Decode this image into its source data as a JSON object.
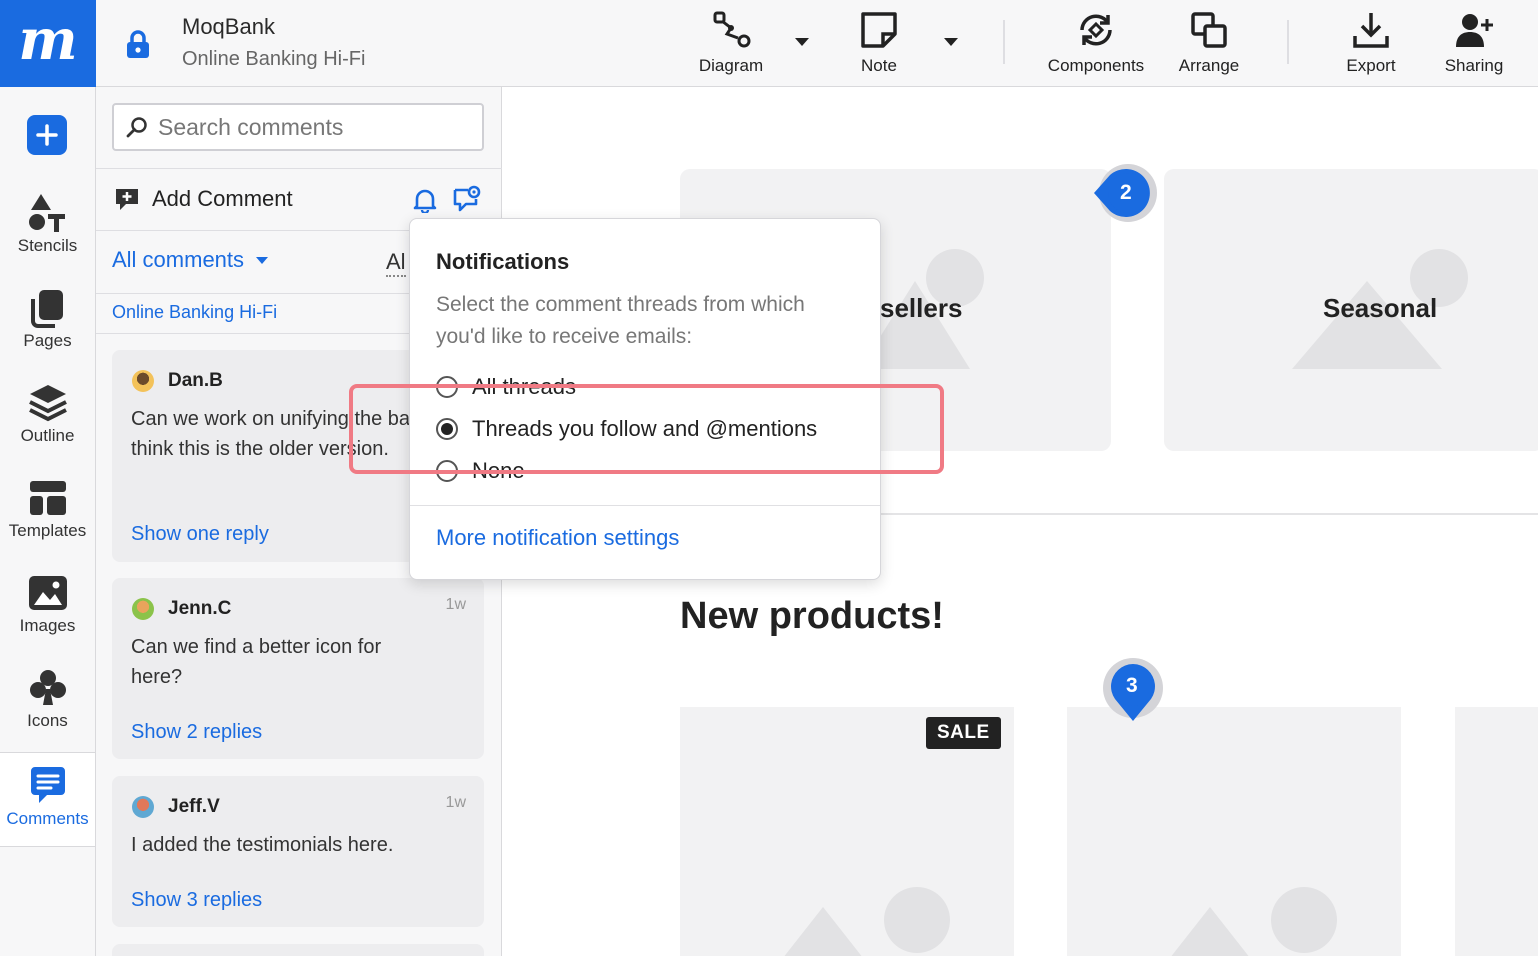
{
  "app": {
    "logo_letter": "m",
    "project_title": "MoqBank",
    "project_subtitle": "Online Banking Hi-Fi",
    "brand_color": "#1a6be0"
  },
  "toolbar": {
    "diagram": "Diagram",
    "note": "Note",
    "components": "Components",
    "arrange": "Arrange",
    "export": "Export",
    "sharing": "Sharing"
  },
  "rail": {
    "items": [
      {
        "label": "Stencils",
        "icon": "stencils-icon"
      },
      {
        "label": "Pages",
        "icon": "pages-icon"
      },
      {
        "label": "Outline",
        "icon": "layers-icon"
      },
      {
        "label": "Templates",
        "icon": "templates-icon"
      },
      {
        "label": "Images",
        "icon": "image-icon"
      },
      {
        "label": "Icons",
        "icon": "club-icon"
      },
      {
        "label": "Comments",
        "icon": "comments-icon"
      }
    ]
  },
  "comments": {
    "search_placeholder": "Search comments",
    "add_label": "Add Comment",
    "filter_label": "All comments",
    "filter_all": "Al",
    "page_name": "Online Banking Hi-Fi",
    "threads": [
      {
        "author": "Dan.B",
        "time": "",
        "text": "Can we work on unifying the bar? I think this is the older version.",
        "reply": "Show one reply"
      },
      {
        "author": "Jenn.C",
        "time": "1w",
        "text": "Can we find a better icon for here?",
        "reply": "Show 2 replies"
      },
      {
        "author": "Jeff.V",
        "time": "1w",
        "text": "I added the testimonials here.",
        "reply": "Show 3 replies"
      }
    ]
  },
  "canvas": {
    "tile_label_1": "sellers",
    "tile_label_2": "Seasonal",
    "heading": "New products!",
    "sale_badge": "SALE",
    "pin_2": "2",
    "pin_3": "3"
  },
  "notifications": {
    "title": "Notifications",
    "description": "Select the comment threads from which you'd like to receive emails:",
    "options": [
      {
        "label": "All threads",
        "selected": false
      },
      {
        "label": "Threads you follow and @mentions",
        "selected": true
      },
      {
        "label": "None",
        "selected": false
      }
    ],
    "more_link": "More notification settings"
  }
}
